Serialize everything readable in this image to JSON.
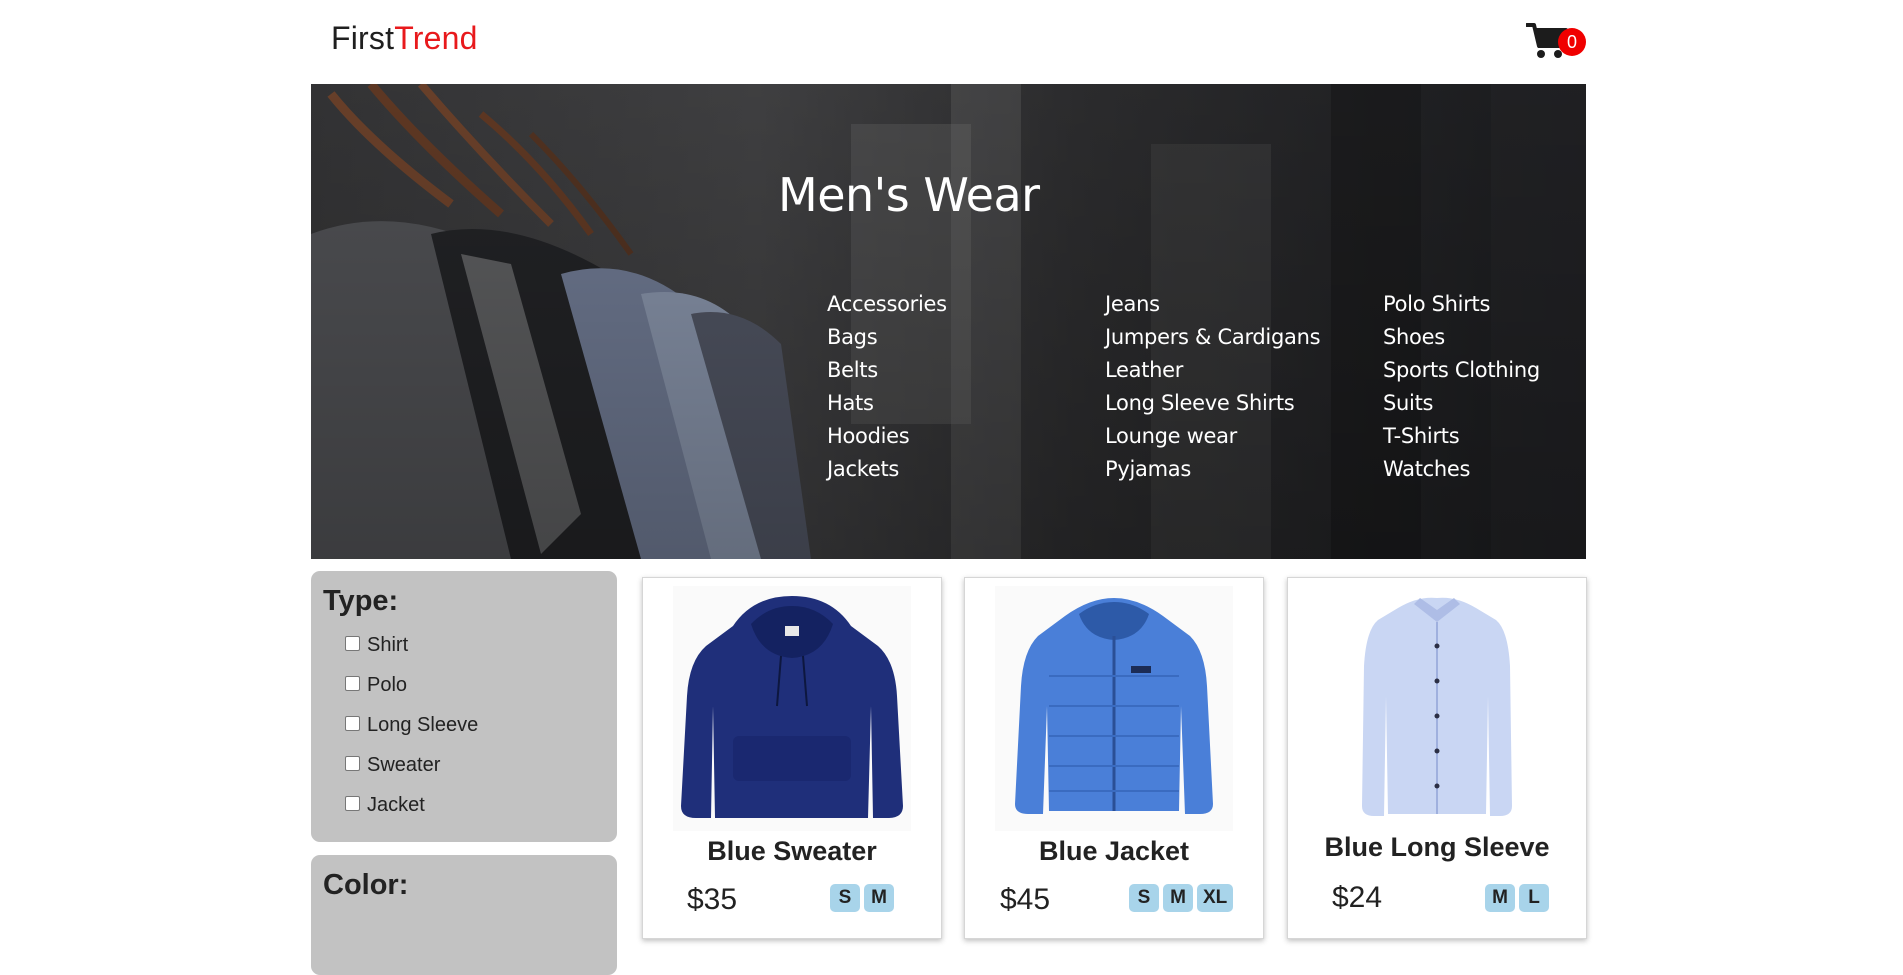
{
  "header": {
    "logo_first": "First",
    "logo_second": "Trend",
    "cart_count": "0"
  },
  "hero": {
    "title": "Men's Wear",
    "categories": [
      [
        "Accessories",
        "Bags",
        "Belts",
        "Hats",
        "Hoodies",
        "Jackets"
      ],
      [
        "Jeans",
        "Jumpers & Cardigans",
        "Leather",
        "Long Sleeve Shirts",
        "Lounge wear",
        "Pyjamas"
      ],
      [
        "Polo Shirts",
        "Shoes",
        "Sports Clothing",
        "Suits",
        "T-Shirts",
        "Watches"
      ]
    ]
  },
  "filters": {
    "type_title": "Type:",
    "type_options": [
      "Shirt",
      "Polo",
      "Long Sleeve",
      "Sweater",
      "Jacket"
    ],
    "color_title": "Color:"
  },
  "products": [
    {
      "name": "Blue Sweater",
      "price": "$35",
      "sizes": [
        "S",
        "M"
      ],
      "image": "navy-hoodie-image"
    },
    {
      "name": "Blue Jacket",
      "price": "$45",
      "sizes": [
        "S",
        "M",
        "XL"
      ],
      "image": "blue-puffer-jacket-image"
    },
    {
      "name": "Blue Long Sleeve",
      "price": "$24",
      "sizes": [
        "M",
        "L"
      ],
      "image": "light-blue-shirt-image"
    }
  ],
  "colors": {
    "brand_red": "#e8191c",
    "badge_red": "#f00000",
    "filter_bg": "#c2c2c2",
    "size_chip": "#a8d4ea"
  }
}
